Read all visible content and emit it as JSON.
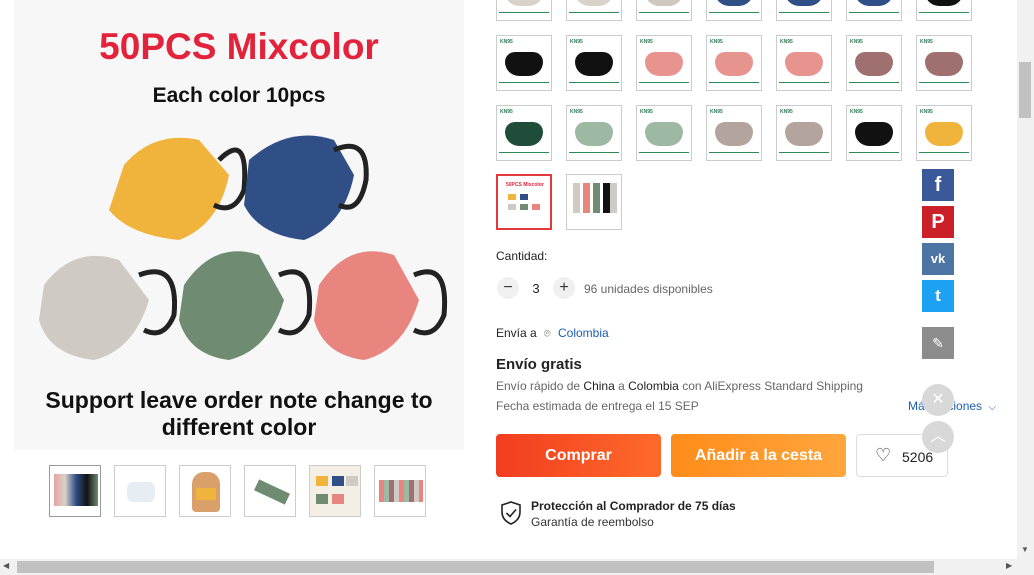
{
  "main_image": {
    "title": "50PCS Mixcolor",
    "subtitle": "Each color 10pcs",
    "bottom_text_line1": "Support leave order note change to",
    "bottom_text_line2": "different color",
    "masks": [
      {
        "color": "#f0b43c"
      },
      {
        "color": "#2f4f86"
      },
      {
        "color": "#cfcac3"
      },
      {
        "color": "#6f8c72"
      },
      {
        "color": "#e9857f"
      }
    ]
  },
  "thumbnails": [
    {
      "id": "thumb-1"
    },
    {
      "id": "thumb-2"
    },
    {
      "id": "thumb-3"
    },
    {
      "id": "thumb-4"
    },
    {
      "id": "thumb-5"
    },
    {
      "id": "thumb-6"
    }
  ],
  "sku_options": {
    "row0": [
      "#d9d2c8",
      "#d9d2c8",
      "#cfc8bf",
      "#2f4f86",
      "#2f4f86",
      "#2f4f86",
      "#111111"
    ],
    "row1": [
      "#111111",
      "#111111",
      "#e8948e",
      "#e8948e",
      "#e8948e",
      "#a07070",
      "#a07070"
    ],
    "row2": [
      "#1f4d3a",
      "#9db8a3",
      "#9db8a3",
      "#b3a59d",
      "#b3a59d",
      "#111111",
      "#f0b43c"
    ],
    "tag": "KN95"
  },
  "quantity": {
    "label": "Cantidad:",
    "value": "3",
    "available": "96 unidades disponibles",
    "minus": "−",
    "plus": "+"
  },
  "shipping": {
    "ship_to_label": "Envía a",
    "country": "Colombia",
    "free_label": "Envío gratis",
    "line1_pre": "Envío rápido de",
    "line1_from": "China",
    "line1_a": "a",
    "line1_to": "Colombia",
    "line1_post": "con AliExpress Standard Shipping",
    "eta": "Fecha estimada de entrega el 15 SEP",
    "more_options": "Más opciones"
  },
  "buttons": {
    "buy": "Comprar",
    "add_to_cart": "Añadir a la cesta",
    "wishlist_count": "5206"
  },
  "protection": {
    "title": "Protección al Comprador de 75 días",
    "subtitle": "Garantía de reembolso"
  },
  "colors": {
    "buy_btn": "#f23d1f",
    "cart_btn": "#ff8c1a",
    "facebook": "#3b5998",
    "pinterest": "#cb2027",
    "vk": "#4c75a3",
    "twitter": "#1da1f2"
  }
}
